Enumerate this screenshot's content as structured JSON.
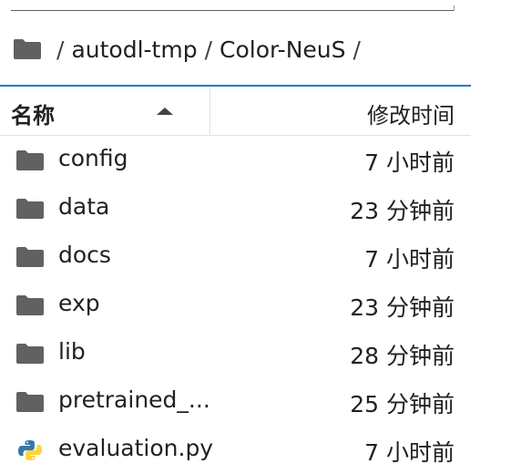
{
  "breadcrumb": {
    "root_sep": "/",
    "items": [
      "autodl-tmp",
      "Color-NeuS"
    ],
    "trailing_sep": "/"
  },
  "table": {
    "headers": {
      "name": "名称",
      "modified": "修改时间"
    },
    "sort": "ascending",
    "rows": [
      {
        "type": "folder",
        "icon": "folder-icon",
        "name": "config",
        "modified": "7 小时前"
      },
      {
        "type": "folder",
        "icon": "folder-icon",
        "name": "data",
        "modified": "23 分钟前"
      },
      {
        "type": "folder",
        "icon": "folder-icon",
        "name": "docs",
        "modified": "7 小时前"
      },
      {
        "type": "folder",
        "icon": "folder-icon",
        "name": "exp",
        "modified": "23 分钟前"
      },
      {
        "type": "folder",
        "icon": "folder-icon",
        "name": "lib",
        "modified": "28 分钟前"
      },
      {
        "type": "folder",
        "icon": "folder-icon",
        "name": "pretrained_...",
        "modified": "25 分钟前"
      },
      {
        "type": "file",
        "icon": "python-icon",
        "name": "evaluation.py",
        "modified": "7 小时前"
      }
    ]
  },
  "colors": {
    "accent": "#1976d2",
    "folder": "#616161",
    "python_blue": "#3776ab",
    "python_yellow": "#ffd43b"
  }
}
